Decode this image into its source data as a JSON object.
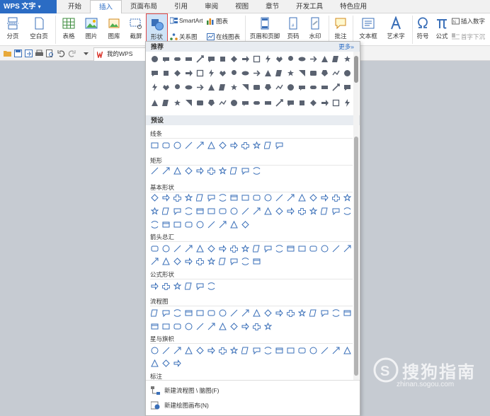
{
  "app": {
    "title": "WPS 文字"
  },
  "tabs": [
    "开始",
    "插入",
    "页面布局",
    "引用",
    "审阅",
    "视图",
    "章节",
    "开发工具",
    "特色应用"
  ],
  "active_tab": "插入",
  "ribbon": {
    "page_break": "分页",
    "blank_page": "空白页",
    "table": "表格",
    "picture": "图片",
    "gallery": "图库",
    "screenshot": "截屏",
    "shapes": "形状",
    "smartart": "SmartArt",
    "chart": "图表",
    "relation": "关系图",
    "online_chart": "在线图表",
    "header_footer": "页眉和页脚",
    "page_number": "页码",
    "watermark": "水印",
    "comment": "批注",
    "textbox": "文本框",
    "wordart": "艺术字",
    "symbol": "符号",
    "formula": "公式",
    "insert_number": "插入数字",
    "drop_cap": "首字下沉"
  },
  "quickbar": {
    "doc_tab": "我的WPS"
  },
  "panel": {
    "recommended": "推荐",
    "more": "更多»",
    "presets": "预设",
    "groups": [
      "线条",
      "矩形",
      "基本形状",
      "箭头总汇",
      "公式形状",
      "流程图",
      "星与旗帜",
      "标注"
    ],
    "footer": [
      "新建流程图 \\ 脑图(F)",
      "新建绘图画布(N)"
    ]
  },
  "colors": {
    "accent": "#2b6cc4",
    "shape_fill": "#5a6270",
    "outline": "#3a6fb8"
  },
  "watermark": {
    "text": "搜狗指南",
    "url": "zhinan.sogou.com"
  }
}
